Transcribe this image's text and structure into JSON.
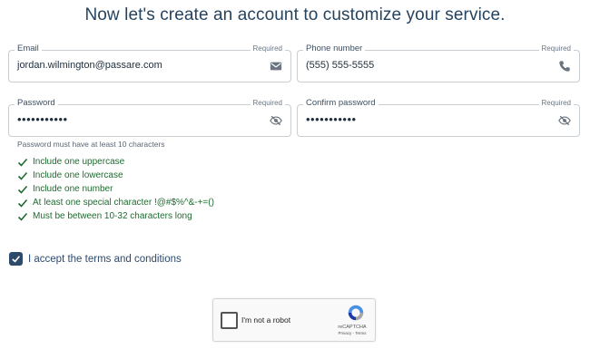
{
  "heading": "Now let's create an account to customize your service.",
  "fields": {
    "email": {
      "label": "Email",
      "required": "Required",
      "value": "jordan.wilmington@passare.com",
      "icon": "envelope-icon"
    },
    "phone": {
      "label": "Phone number",
      "required": "Required",
      "value": "(555) 555-5555",
      "icon": "phone-icon"
    },
    "password": {
      "label": "Password",
      "required": "Required",
      "value": "•••••••••••",
      "icon": "eye-slash-icon"
    },
    "confirm": {
      "label": "Confirm password",
      "required": "Required",
      "value": "•••••••••••",
      "icon": "eye-slash-icon"
    }
  },
  "password_hint": "Password must have at least 10 characters",
  "rules": [
    "Include one uppercase",
    "Include one lowercase",
    "Include one number",
    "At least one special character !@#$%^&-+=()",
    "Must be between 10-32 characters long"
  ],
  "terms": {
    "label": "I accept the terms and conditions",
    "checked": true
  },
  "captcha": {
    "label": "I'm not a robot",
    "brand": "reCAPTCHA",
    "links": "Privacy - Terms"
  },
  "colors": {
    "heading": "#25435f",
    "success": "#1e6b2f",
    "accent": "#2d4a6b"
  }
}
